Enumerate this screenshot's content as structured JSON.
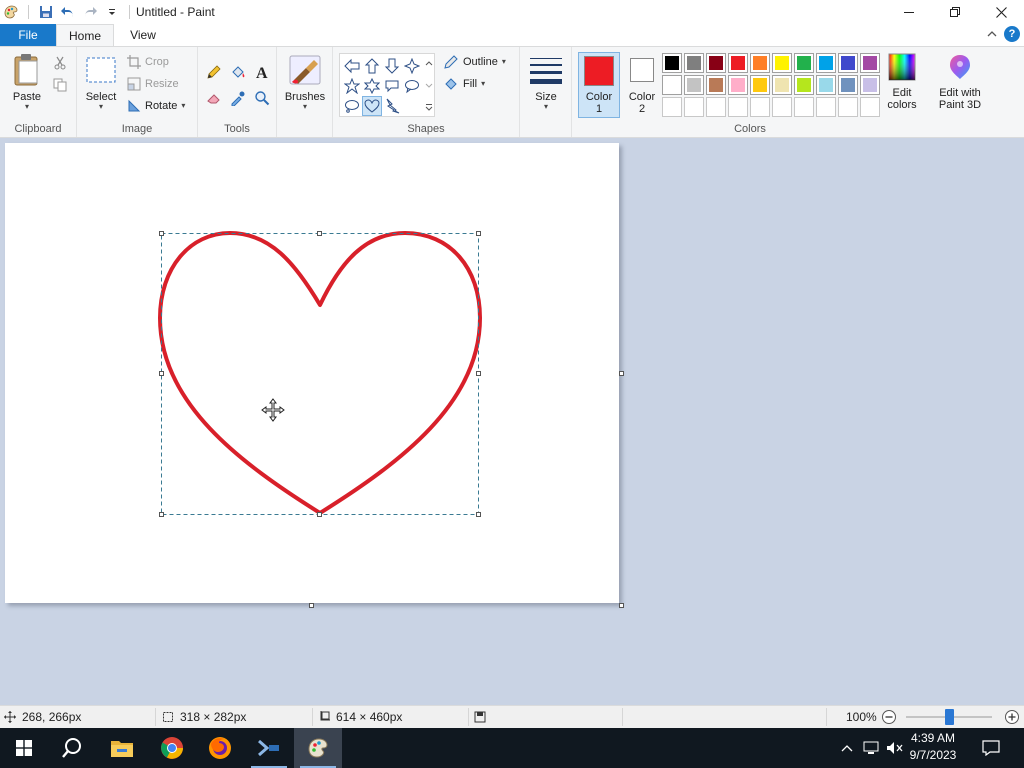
{
  "window": {
    "title": "Untitled - Paint",
    "minimize_icon": "minimize-icon",
    "maximize_icon": "restore-icon",
    "close_icon": "close-icon"
  },
  "quick_access": [
    "paint-app-icon",
    "save-icon",
    "undo-icon",
    "redo-icon",
    "customize-dropdown-icon"
  ],
  "tabs": [
    {
      "label": "File"
    },
    {
      "label": "Home"
    },
    {
      "label": "View"
    }
  ],
  "help_label": "?",
  "ribbon": {
    "clipboard": {
      "label": "Clipboard",
      "paste": "Paste"
    },
    "image": {
      "label": "Image",
      "select": "Select",
      "crop": "Crop",
      "resize": "Resize",
      "rotate": "Rotate"
    },
    "tools": {
      "label": "Tools"
    },
    "brushes": {
      "label": "Brushes"
    },
    "shapes": {
      "label": "Shapes",
      "outline": "Outline",
      "fill": "Fill"
    },
    "size": {
      "label": "Size"
    },
    "colors": {
      "label": "Colors",
      "color1_label": "Color 1",
      "color1_line1": "Color",
      "color1_line2": "1",
      "color1_value": "#ed1c24",
      "color2_line1": "Color",
      "color2_line2": "2",
      "color2_value": "#ffffff",
      "edit_colors_line1": "Edit",
      "edit_colors_line2": "colors",
      "paint3d_line1": "Edit with",
      "paint3d_line2": "Paint 3D",
      "palette_row1": [
        "#000000",
        "#7f7f7f",
        "#880015",
        "#ed1c24",
        "#ff7f27",
        "#fff200",
        "#22b14c",
        "#00a2e8",
        "#3f48cc",
        "#a349a4"
      ],
      "palette_row2": [
        "#ffffff",
        "#c3c3c3",
        "#b97a57",
        "#ffaec9",
        "#ffc90e",
        "#efe4b0",
        "#b5e61d",
        "#99d9ea",
        "#7092be",
        "#c8bfe7"
      ],
      "palette_row3": [
        "#ffffff",
        "#ffffff",
        "#ffffff",
        "#ffffff",
        "#ffffff",
        "#ffffff",
        "#ffffff",
        "#ffffff",
        "#ffffff",
        "#ffffff"
      ]
    }
  },
  "canvas": {
    "shape": "heart",
    "stroke_color": "#d8202a",
    "background": "#ffffff"
  },
  "status": {
    "cursor_pos": "268, 266px",
    "selection_size": "318 × 282px",
    "image_size": "614 × 460px",
    "zoom": "100%",
    "zoom_fraction": 0.5
  },
  "taskbar": {
    "apps": [
      "start-icon",
      "search-icon",
      "file-explorer-icon",
      "chrome-icon",
      "firefox-icon",
      "terminal-app-icon",
      "paint-app-icon"
    ],
    "time": "4:39 AM",
    "date": "9/7/2023"
  }
}
